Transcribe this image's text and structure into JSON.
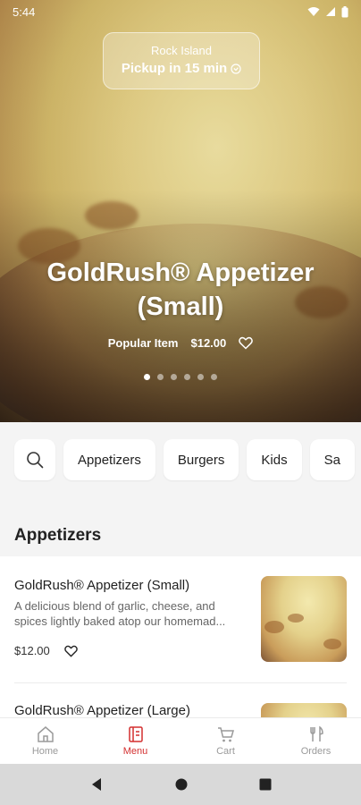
{
  "status_bar": {
    "time": "5:44"
  },
  "hero": {
    "location": "Rock Island",
    "pickup": "Pickup in 15 min",
    "title_line1": "GoldRush® Appetizer",
    "title_line2": "(Small)",
    "tag": "Popular Item",
    "price": "$12.00",
    "slide_count": 6,
    "active_slide": 1
  },
  "categories": [
    "Appetizers",
    "Burgers",
    "Kids",
    "Sa"
  ],
  "section_title": "Appetizers",
  "items": [
    {
      "title": "GoldRush® Appetizer (Small)",
      "description": "A delicious blend of garlic, cheese, and spices lightly baked atop our homemad...",
      "price": "$12.00"
    },
    {
      "title": "GoldRush® Appetizer (Large)"
    }
  ],
  "bottom_nav": {
    "home": "Home",
    "menu": "Menu",
    "cart": "Cart",
    "orders": "Orders",
    "active": "menu"
  },
  "colors": {
    "accent": "#d32f2f",
    "chip_bg": "#ffffff",
    "bar_bg": "#f4f4f4"
  }
}
